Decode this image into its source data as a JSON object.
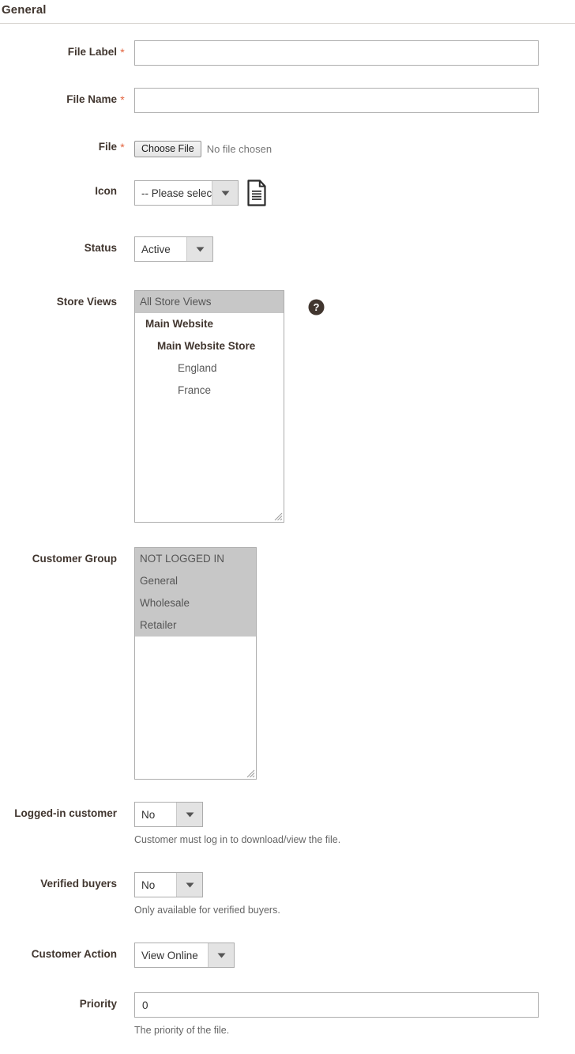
{
  "section": {
    "title": "General"
  },
  "fields": {
    "file_label": {
      "label": "File Label",
      "required_marker": "*",
      "value": "",
      "placeholder": ""
    },
    "file_name": {
      "label": "File Name",
      "required_marker": "*",
      "value": "",
      "placeholder": ""
    },
    "file": {
      "label": "File",
      "required_marker": "*",
      "button_label": "Choose File",
      "status_text": "No file chosen"
    },
    "icon": {
      "label": "Icon",
      "selected": "-- Please select --",
      "preview_icon": "document-file-icon"
    },
    "status": {
      "label": "Status",
      "selected": "Active"
    },
    "store_views": {
      "label": "Store Views",
      "help_icon": "help-circle-icon",
      "options": [
        {
          "text": "All Store Views",
          "level": "all",
          "selected": true
        },
        {
          "text": "Main Website",
          "level": "website",
          "selected": false
        },
        {
          "text": "Main Website Store",
          "level": "store",
          "selected": false
        },
        {
          "text": "England",
          "level": "view",
          "selected": false
        },
        {
          "text": "France",
          "level": "view",
          "selected": false
        }
      ]
    },
    "customer_group": {
      "label": "Customer Group",
      "options": [
        {
          "text": "NOT LOGGED IN",
          "selected": true
        },
        {
          "text": "General",
          "selected": true
        },
        {
          "text": "Wholesale",
          "selected": true
        },
        {
          "text": "Retailer",
          "selected": true
        }
      ]
    },
    "logged_in_customer": {
      "label": "Logged-in customer",
      "selected": "No",
      "note": "Customer must log in to download/view the file."
    },
    "verified_buyers": {
      "label": "Verified buyers",
      "selected": "No",
      "note": "Only available for verified buyers."
    },
    "customer_action": {
      "label": "Customer Action",
      "selected": "View Online"
    },
    "priority": {
      "label": "Priority",
      "value": "0",
      "note": "The priority of the file."
    }
  },
  "colors": {
    "required_asterisk": "#e3643f",
    "label_text": "#41362f",
    "selection_highlight": "#c7c7c7",
    "border": "#adadad",
    "note_text": "#666666"
  }
}
